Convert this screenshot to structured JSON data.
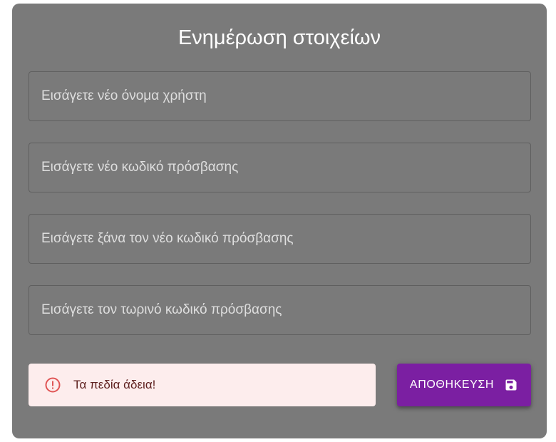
{
  "form": {
    "title": "Ενημέρωση στοιχείων",
    "fields": [
      {
        "placeholder": "Εισάγετε νέο όνομα χρήστη",
        "value": ""
      },
      {
        "placeholder": "Εισάγετε νέο κωδικό πρόσβασης",
        "value": ""
      },
      {
        "placeholder": "Εισάγετε ξάνα τον νέο κωδικό πρόσβασης",
        "value": ""
      },
      {
        "placeholder": "Εισάγετε τον τωρινό κωδικό πρόσβασης",
        "value": ""
      }
    ],
    "alert": {
      "message": "Τα πεδία άδεια!",
      "icon": "error-outline-icon",
      "severity_color": "#e05555"
    },
    "save_button": {
      "label": "ΑΠΟΘΗΚΕΥΣΗ",
      "icon": "save-icon",
      "color": "#7b1fa2"
    }
  }
}
